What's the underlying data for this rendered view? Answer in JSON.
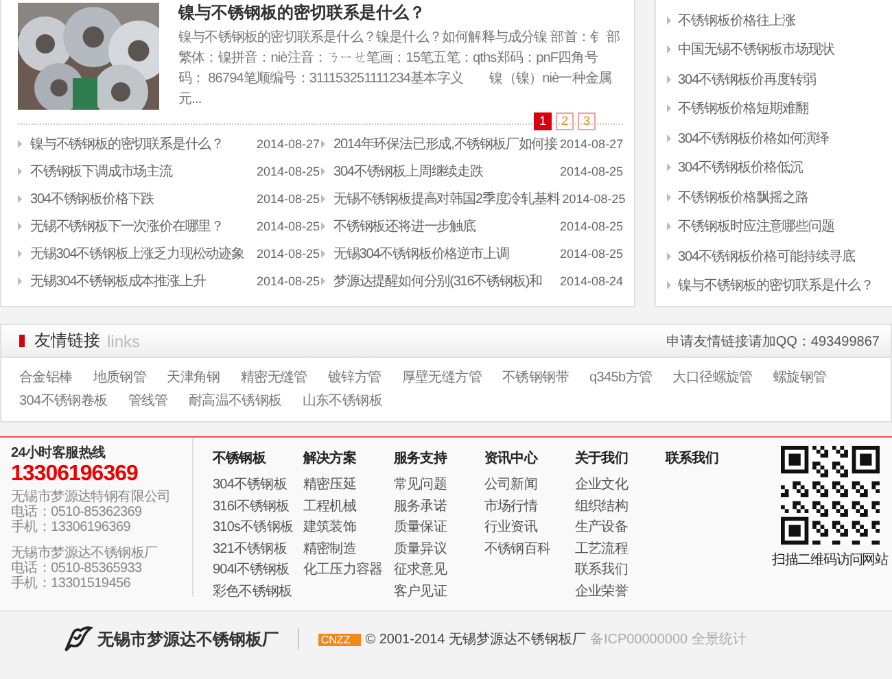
{
  "article": {
    "title": "镍与不锈钢板的密切联系是什么？",
    "excerpt": "镍与不锈钢板的密切联系是什么？镍是什么？如何解释与成分镍 部首：钅 部繁体：镍拼音：niè注音：ㄋㄧㄝ笔画：15笔五笔：qths郑码：pnF四角号码： 86794笔顺编号：311153251111234基本字义　　镍（镍）niè一种金属元...",
    "pages": [
      {
        "label": "1",
        "selected": true
      },
      {
        "label": "2",
        "selected": false
      },
      {
        "label": "3",
        "selected": false
      }
    ]
  },
  "news": [
    {
      "title": "镍与不锈钢板的密切联系是什么？",
      "date": "2014-08-27"
    },
    {
      "title": "2014年环保法已形成,不锈钢板厂如何接",
      "date": "2014-08-27"
    },
    {
      "title": "不锈钢板下调成市场主流",
      "date": "2014-08-25"
    },
    {
      "title": "304不锈钢板上周继续走跌",
      "date": "2014-08-25"
    },
    {
      "title": "304不锈钢板价格下跌",
      "date": "2014-08-25"
    },
    {
      "title": "无锡不锈钢板提高对韩国2季度冷轧基料",
      "date": "2014-08-25"
    },
    {
      "title": "无锡不锈钢板下一次涨价在哪里？",
      "date": "2014-08-25"
    },
    {
      "title": "不锈钢板还将进一步触底",
      "date": "2014-08-25"
    },
    {
      "title": "无锡304不锈钢板上涨乏力现松动迹象",
      "date": "2014-08-25"
    },
    {
      "title": "无锡304不锈钢板价格逆市上调",
      "date": "2014-08-25"
    },
    {
      "title": "无锡304不锈钢板成本推涨上升",
      "date": "2014-08-25"
    },
    {
      "title": "梦源达提醒如何分别(316不锈钢板)和",
      "date": "2014-08-24"
    }
  ],
  "sidebar": {
    "items": [
      "不锈钢板价格往上涨",
      "中国无锡不锈钢板市场现状",
      "304不锈钢板价再度转弱",
      "不锈钢板价格短期难翻",
      "304不锈钢板价格如何演绎",
      "304不锈钢板价格低沉",
      "不锈钢板价格飘摇之路",
      "不锈钢板时应注意哪些问题",
      "304不锈钢板价格可能持续寻底",
      "镍与不锈钢板的密切联系是什么？"
    ]
  },
  "links": {
    "title": "友情链接",
    "subtitle": "links",
    "apply": "申请友情链接请加QQ：493499867",
    "items": [
      "合金铝棒",
      "地质钢管",
      "天津角钢",
      "精密无缝管",
      "镀锌方管",
      "厚壁无缝方管",
      "不锈钢钢带",
      "q345b方管",
      "大口径螺旋管",
      "螺旋钢管",
      "304不锈钢卷板",
      "管线管",
      "耐高温不锈钢板",
      "山东不锈钢板"
    ]
  },
  "footer": {
    "hotline_label": "24小时客服热线",
    "hotline": "13306196369",
    "contacts": [
      [
        "无锡市梦源达特钢有限公司",
        "电话：0510-85362369",
        "手机：13306196369"
      ],
      [
        "无锡市梦源达不锈钢板厂",
        "电话：0510-85365933",
        "手机：13301519456"
      ]
    ],
    "columns": [
      {
        "title": "不锈钢板",
        "items": [
          "304不锈钢板",
          "316l不锈钢板",
          "310s不锈钢板",
          "321不锈钢板",
          "904l不锈钢板",
          "彩色不锈钢板"
        ]
      },
      {
        "title": "解决方案",
        "items": [
          "精密压延",
          "工程机械",
          "建筑装饰",
          "精密制造",
          "化工压力容器"
        ]
      },
      {
        "title": "服务支持",
        "items": [
          "常见问题",
          "服务承诺",
          "质量保证",
          "质量异议",
          "征求意见",
          "客户见证"
        ]
      },
      {
        "title": "资讯中心",
        "items": [
          "公司新闻",
          "市场行情",
          "行业资讯",
          "不锈钢百科"
        ]
      },
      {
        "title": "关于我们",
        "items": [
          "企业文化",
          "组织结构",
          "生产设备",
          "工艺流程",
          "联系我们",
          "企业荣誉"
        ]
      },
      {
        "title": "联系我们"
      }
    ],
    "qr_caption": "扫描二维码访问网站"
  },
  "bottom": {
    "logo": "无锡市梦源达不锈钢板厂",
    "badge": "CNZZ",
    "copyright": "© 2001-2014 无锡梦源达不锈钢板厂",
    "icp": "备ICP00000000",
    "stats": "全景统计"
  }
}
